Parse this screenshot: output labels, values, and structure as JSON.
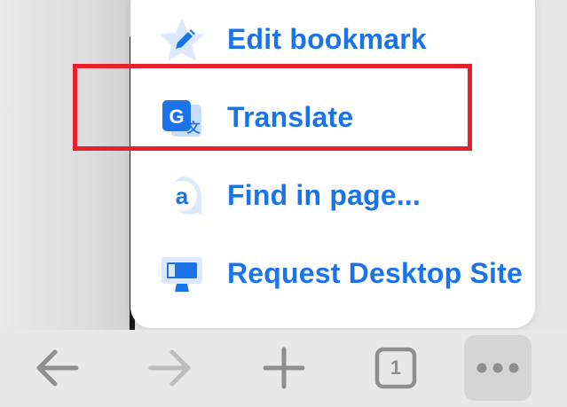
{
  "menu": {
    "items": [
      {
        "label": "Edit bookmark",
        "icon": "edit-bookmark-star-icon"
      },
      {
        "label": "Translate",
        "icon": "translate-icon"
      },
      {
        "label": "Find in page...",
        "icon": "find-in-page-icon"
      },
      {
        "label": "Request Desktop Site",
        "icon": "desktop-site-icon"
      }
    ],
    "highlighted_item": "Translate",
    "accent_color": "#1a73e8",
    "highlight_color": "#e8202e"
  },
  "toolbar": {
    "back_icon": "back-arrow-icon",
    "forward_icon": "forward-arrow-icon",
    "new_tab_icon": "plus-icon",
    "tab_count": "1",
    "more_icon": "more-dots-icon"
  }
}
